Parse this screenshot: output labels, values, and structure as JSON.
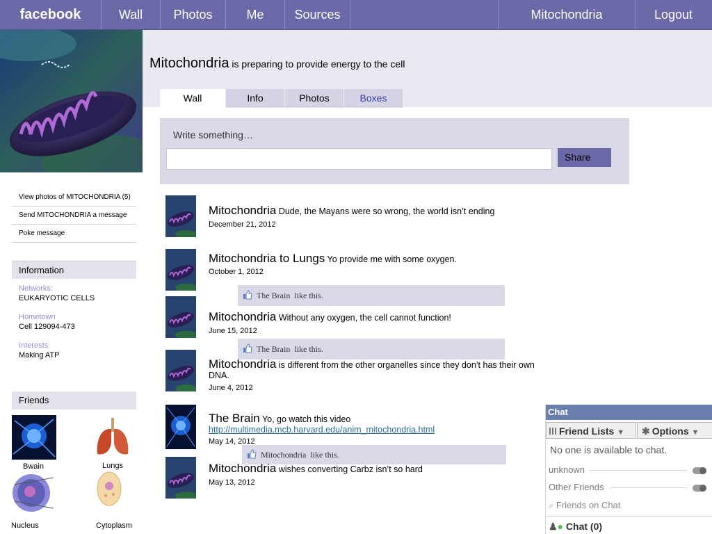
{
  "nav": {
    "logo": "facebook",
    "items": [
      "Wall",
      "Photos",
      "Me",
      "Sources"
    ],
    "profile_link": "Mitochondria",
    "logout": "Logout"
  },
  "profile": {
    "name": "Mitochondria",
    "status": "is preparing to provide energy to the cell"
  },
  "tabs": [
    "Wall",
    "Info",
    "Photos",
    "Boxes"
  ],
  "composer": {
    "placeholder": "Write something…",
    "share_label": "Share"
  },
  "sidebar": {
    "links": [
      "View photos of MITOCHONDRIA (5)",
      "Send MITOCHONDRIA a message",
      "Poke message"
    ],
    "information_title": "Information",
    "info": [
      {
        "label": "Networks:",
        "value": "EUKARYOTIC CELLS"
      },
      {
        "label": "Hometown",
        "value": "Cell 129094-473"
      },
      {
        "label": "Interests",
        "value": "Making  ATP"
      }
    ],
    "friends_title": "Friends",
    "friends": [
      "Bwain",
      "Lungs",
      "Nucleus",
      "Cytoplasm"
    ]
  },
  "posts": [
    {
      "author": "Mitochondria",
      "text": "Dude, the Mayans were so wrong, the world isn’t ending",
      "date": "December 21, 2012"
    },
    {
      "author": "Mitochondria to Lungs",
      "text": " Yo provide me with some oxygen.",
      "date": "October 1, 2012",
      "like": "The Brain",
      "like_suffix": "like this."
    },
    {
      "author": "Mitochondria",
      "text": "Without any oxygen, the cell cannot function!",
      "date": "June 15, 2012",
      "like": "The Brain",
      "like_suffix": "like this."
    },
    {
      "author": "Mitochondria",
      "text": "is different from the other organelles since they don’t has their own DNA.",
      "date": "June 4, 2012"
    },
    {
      "author": "The Brain",
      "text": "Yo, go watch this video",
      "link": "http://multimedia.mcb.harvard.edu/anim_mitochondria.html",
      "date": "May 14, 2012",
      "like": "Mitochondria",
      "like_suffix": "like this."
    },
    {
      "author": "Mitochondria",
      "text": "wishes converting Carbz isn’t so hard",
      "date": "May 13, 2012"
    }
  ],
  "chat": {
    "title": "Chat",
    "friend_lists": "Friend Lists",
    "options": "Options",
    "none_available": "No one is available to chat.",
    "groups": [
      "unknown",
      "Other Friends"
    ],
    "search_placeholder": "Friends on Chat",
    "footer": "Chat (0)"
  },
  "colors": {
    "topbar": "#6b69a8",
    "chat_header": "#6b7fae",
    "info_label": "#8e8ed0"
  }
}
